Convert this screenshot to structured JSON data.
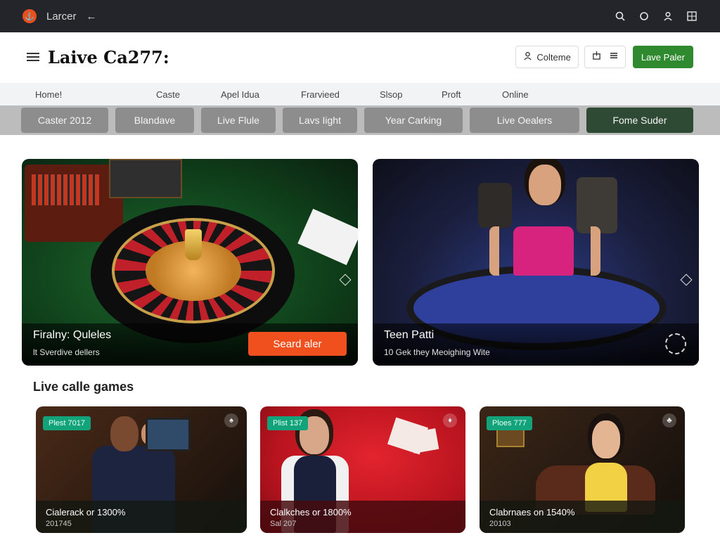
{
  "topbar": {
    "app_name": "Larcer",
    "back_glyph": "←",
    "icons": [
      "search-icon",
      "circle-icon",
      "user-icon",
      "grid-icon"
    ]
  },
  "header": {
    "title": "Laive Ca277:",
    "outline_button_label": "Colteme",
    "primary_button_label": "Lave Paler"
  },
  "nav": {
    "items": [
      "Home!",
      "Caste",
      "Apel Idua",
      "Frarvieed",
      "Slsop",
      "Proft",
      "Online"
    ]
  },
  "chips": {
    "items": [
      {
        "label": "Caster 2012",
        "active": false
      },
      {
        "label": "Blandave",
        "active": false
      },
      {
        "label": "Live Flule",
        "active": false
      },
      {
        "label": "Lavs Iight",
        "active": false
      },
      {
        "label": "Year Carking",
        "active": false
      },
      {
        "label": "Live Oealers",
        "active": false
      },
      {
        "label": "Fome Suder",
        "active": true
      }
    ]
  },
  "hero": [
    {
      "title": "Firalny: Quleles",
      "subtitle": "lt Sverdive dellers",
      "button_label": "Seard aler"
    },
    {
      "title": "Teen Patti",
      "subtitle": "10 Gek they Meoighing Wite"
    }
  ],
  "section_title": "Live calle games",
  "games": [
    {
      "badge": "Plest 7017",
      "name": "Cialerack or 1300%",
      "meta": "201745"
    },
    {
      "badge": "Plist 137",
      "name": "Clalkches or 1800%",
      "meta": "Sal 207"
    },
    {
      "badge": "Ploes 777",
      "name": "Clabrnaes on 1540%",
      "meta": "20103"
    }
  ],
  "colors": {
    "accent_orange": "#f0501e",
    "primary_green": "#2f8a2f",
    "active_chip": "#2f4a34",
    "badge_teal": "#12a37a"
  }
}
